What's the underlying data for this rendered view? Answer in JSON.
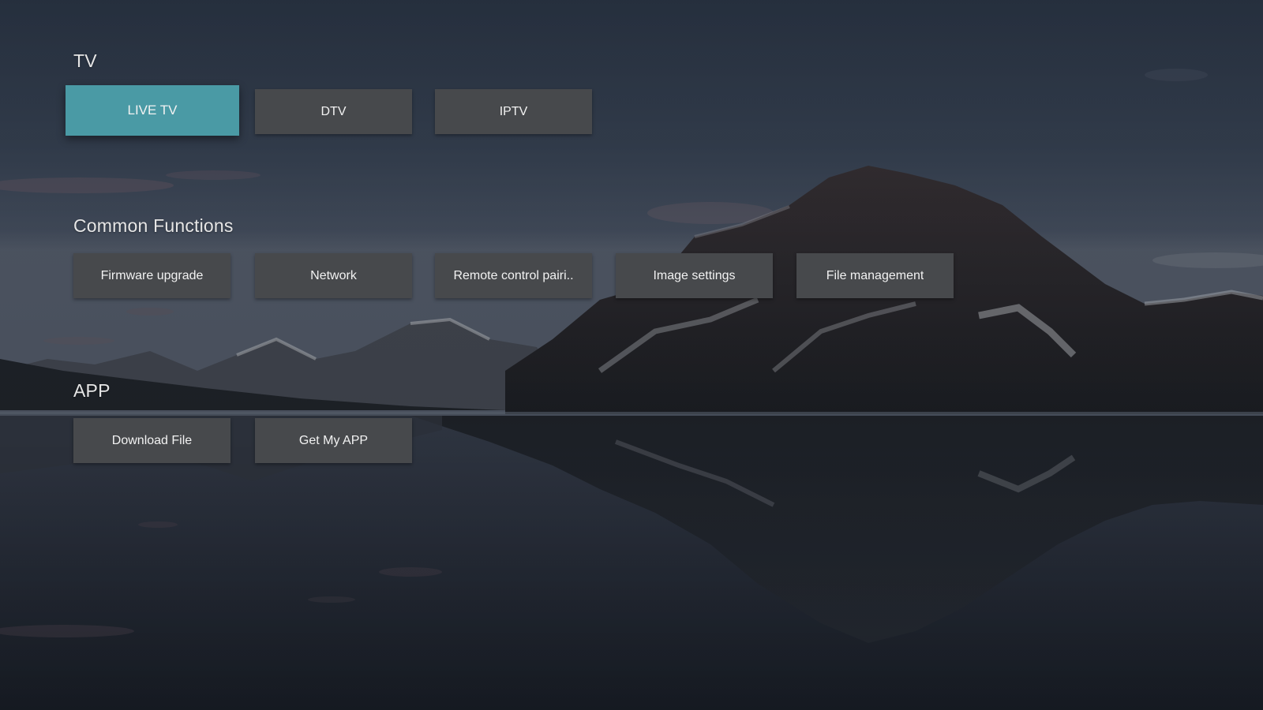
{
  "theme": {
    "tile_bg": "#47494c",
    "focus_bg": "#4a9aa5",
    "text_color": "#f2f2f2"
  },
  "sections": [
    {
      "title": "TV",
      "items": [
        {
          "label": "LIVE TV",
          "focused": true
        },
        {
          "label": "DTV",
          "focused": false
        },
        {
          "label": "IPTV",
          "focused": false
        }
      ]
    },
    {
      "title": "Common Functions",
      "items": [
        {
          "label": "Firmware upgrade",
          "focused": false
        },
        {
          "label": "Network",
          "focused": false
        },
        {
          "label": "Remote control pairi..",
          "focused": false
        },
        {
          "label": "Image settings",
          "focused": false
        },
        {
          "label": "File management",
          "focused": false
        }
      ]
    },
    {
      "title": "APP",
      "items": [
        {
          "label": "Download File",
          "focused": false
        },
        {
          "label": "Get My APP",
          "focused": false
        }
      ]
    }
  ]
}
